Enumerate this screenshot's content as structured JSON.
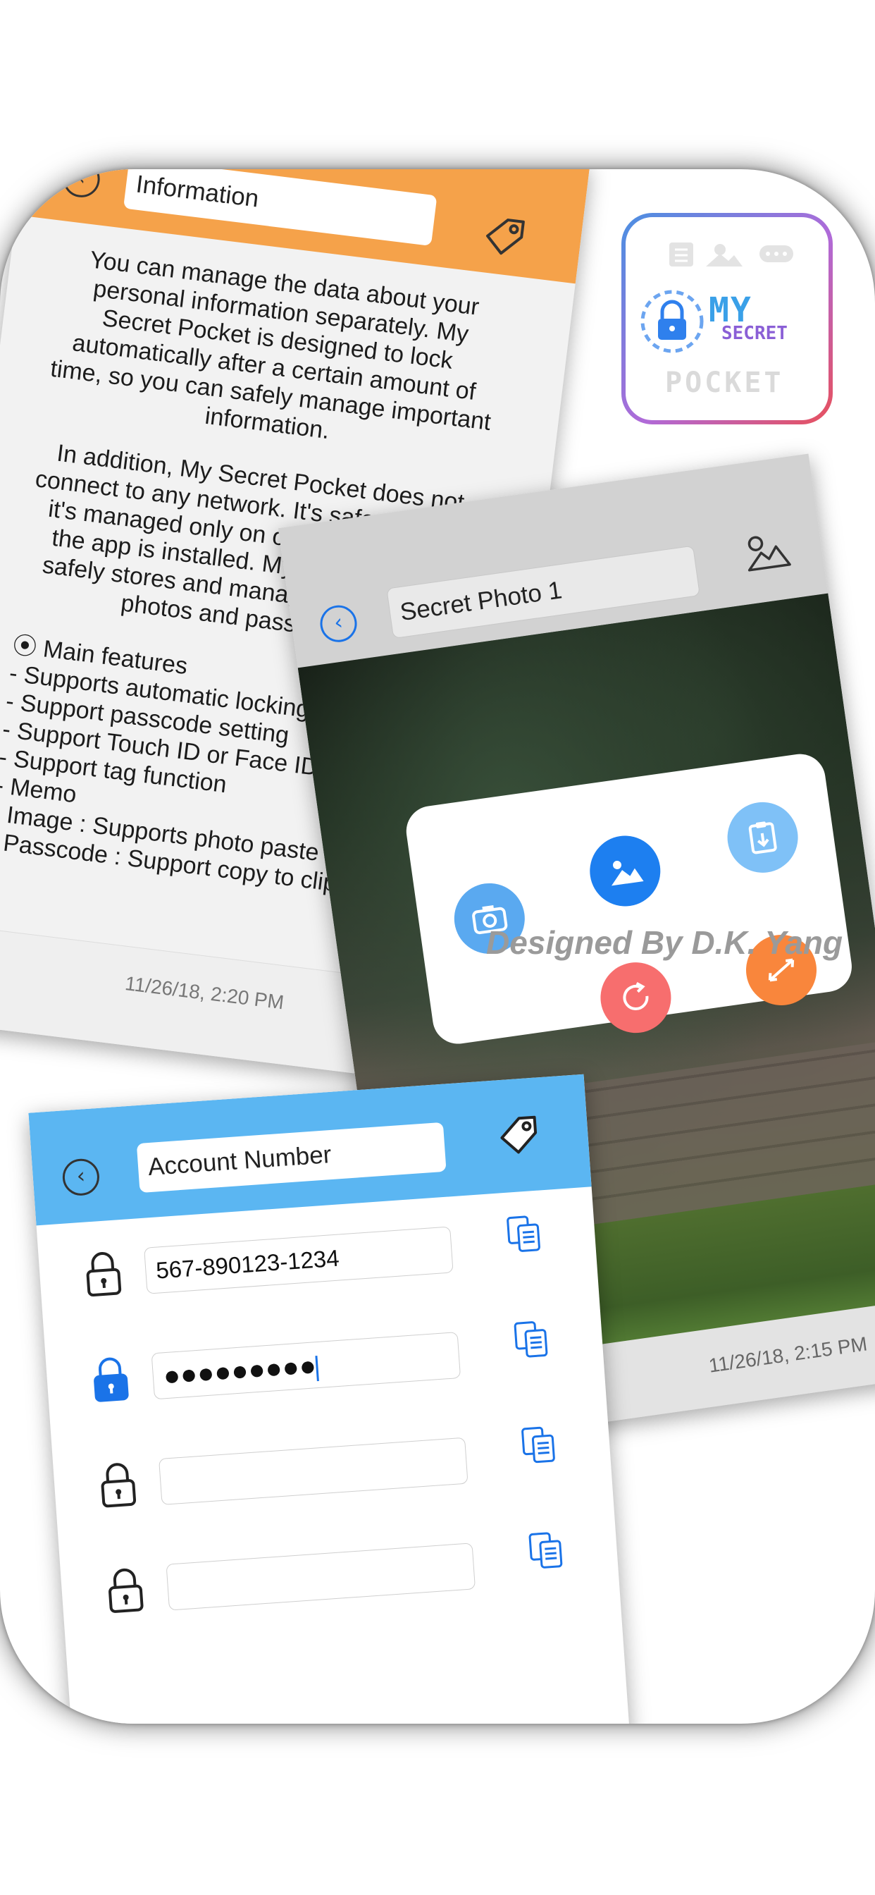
{
  "logo": {
    "word_my": "MY",
    "word_secret": "SECRET",
    "word_pocket": "POCKET"
  },
  "info_screen": {
    "title": "Information",
    "paragraph1": "You can manage the data about your personal information separately. My Secret Pocket is designed to lock automatically after a certain amount of time, so you can safely manage important information.",
    "paragraph2": "In addition, My Secret Pocket does not connect to any network. It's safer because it's managed only on one device where the app is installed. My Secret Pocket safely stores and manages your notes, photos and passwords.",
    "features": [
      "⦿ Main features",
      "- Supports automatic locking",
      "- Support passcode setting",
      "- Support Touch ID or Face ID",
      "- Support tag function",
      "- Memo",
      "- Image : Supports photo paste",
      "- Passcode : Support copy to clipboard"
    ],
    "date": "11/26/18, 2:20 PM"
  },
  "photo_screen": {
    "title": "Secret Photo 1",
    "date": "11/26/18, 2:15 PM",
    "action_icons": [
      "camera-icon",
      "photo-library-icon",
      "clipboard-paste-icon",
      "rotate-icon",
      "resize-icon"
    ],
    "colors": {
      "camera": "#5aa9f0",
      "library": "#1d7ff0",
      "paste": "#7fc1f7",
      "rotate": "#f76e6e",
      "resize": "#f9863c"
    }
  },
  "account_screen": {
    "title": "Account Number",
    "rows": [
      {
        "value": "567-890123-1234",
        "lock": "locked-black"
      },
      {
        "value": "●●●●●●●●●",
        "lock": "locked-blue"
      },
      {
        "value": "",
        "lock": "locked-black"
      },
      {
        "value": "",
        "lock": "locked-black"
      }
    ]
  },
  "credit": "Designed By D.K. Yang",
  "colors": {
    "info_bar": "#f5a24a",
    "account_bar": "#5bb6f2",
    "accent_blue": "#1a73e8"
  }
}
